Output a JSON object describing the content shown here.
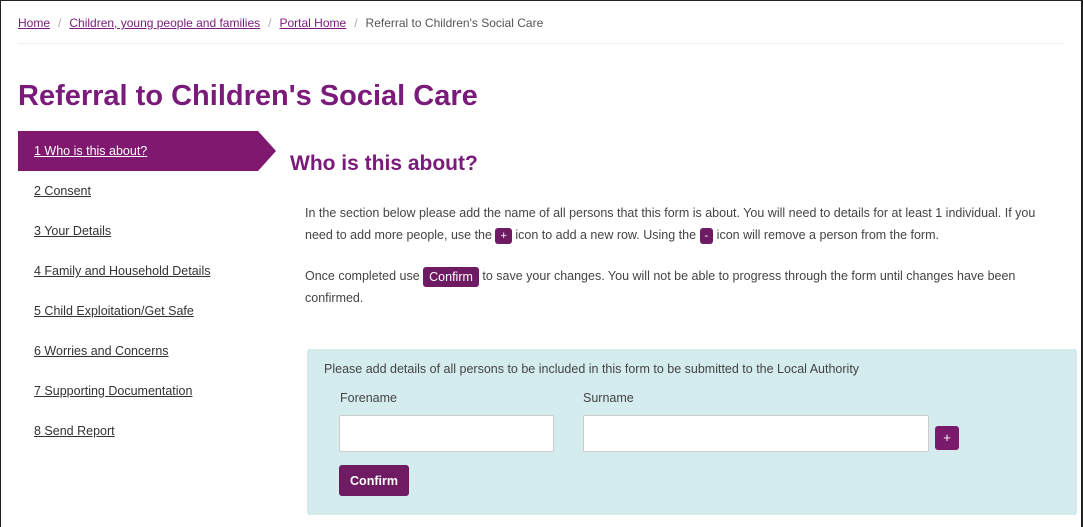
{
  "breadcrumb": {
    "items": [
      "Home",
      "Children, young people and families",
      "Portal Home"
    ],
    "current": "Referral to Children's Social Care",
    "separator": "/"
  },
  "page": {
    "title": "Referral to Children's Social Care"
  },
  "sidebar": {
    "items": [
      {
        "label": "1 Who is this about?",
        "active": true
      },
      {
        "label": "2 Consent",
        "active": false
      },
      {
        "label": "3 Your Details",
        "active": false
      },
      {
        "label": "4 Family and Household Details",
        "active": false
      },
      {
        "label": "5 Child Exploitation/Get Safe",
        "active": false
      },
      {
        "label": "6 Worries and Concerns",
        "active": false
      },
      {
        "label": "7 Supporting Documentation",
        "active": false
      },
      {
        "label": "8 Send Report",
        "active": false
      }
    ]
  },
  "main": {
    "heading": "Who is this about?",
    "para1": {
      "part1": "In the section below please add the name of all persons that this form is about. You will need to details for at least 1 individual. If you need to add more people, use the",
      "plus_label": "+",
      "part2": "icon to add a new row. Using the",
      "minus_label": "-",
      "part3": "icon will remove a person from the form."
    },
    "para2": {
      "part1": "Once completed use",
      "confirm_label": "Confirm",
      "part2": "to save your changes. You will not be able to progress through the form until changes have been confirmed."
    }
  },
  "panel": {
    "intro": "Please add details of all persons to be included in this form to be submitted to the Local Authority",
    "forename_label": "Forename",
    "forename_value": "",
    "surname_label": "Surname",
    "surname_value": "",
    "add_button": "+",
    "confirm_button": "Confirm"
  },
  "colors": {
    "brand": "#7a1a7a",
    "button": "#6f1b63",
    "panel_bg": "#d5ecee"
  }
}
